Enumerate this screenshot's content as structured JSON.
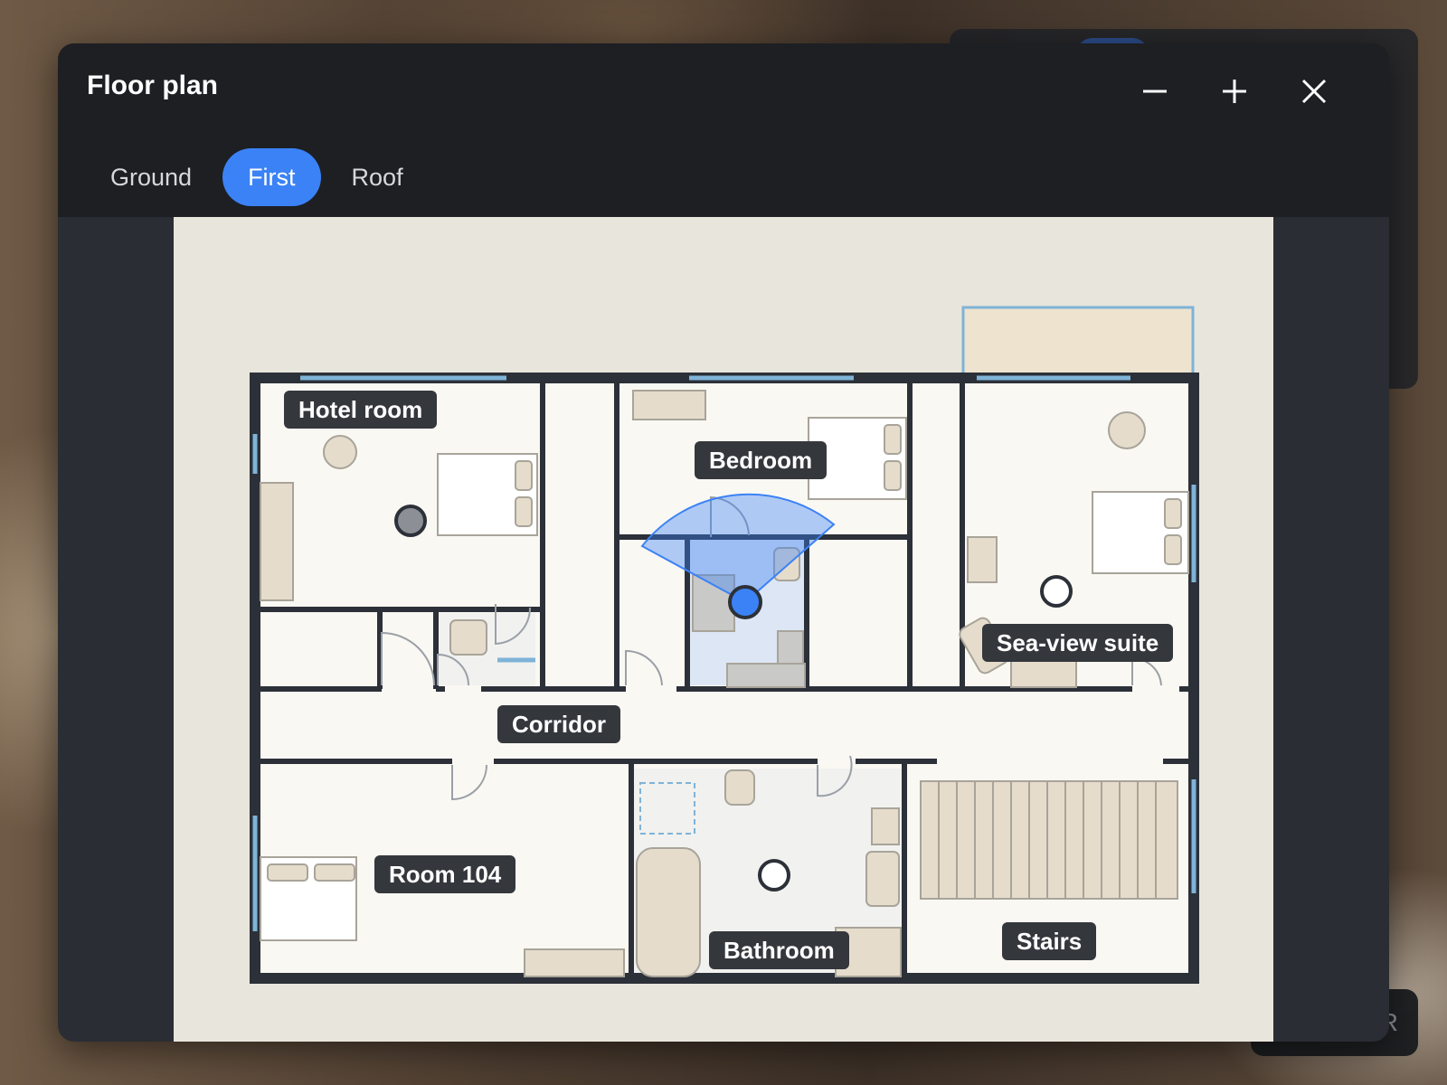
{
  "panel": {
    "title": "Floor plan",
    "zoom_out_icon": "minus-icon",
    "zoom_in_icon": "plus-icon",
    "close_icon": "close-icon"
  },
  "floors": [
    {
      "label": "Ground",
      "active": false
    },
    {
      "label": "First",
      "active": true
    },
    {
      "label": "Roof",
      "active": false
    }
  ],
  "rooms": [
    {
      "label": "Hotel room"
    },
    {
      "label": "Bedroom"
    },
    {
      "label": "Sea-view suite"
    },
    {
      "label": "Corridor"
    },
    {
      "label": "Room 104"
    },
    {
      "label": "Bathroom"
    },
    {
      "label": "Stairs"
    }
  ],
  "background": {
    "vr_button_label": "Enter VR"
  },
  "colors": {
    "accent": "#3b82f6",
    "wall": "#2c3038",
    "window": "#7fb3d8",
    "floor": "#faf8f2"
  }
}
